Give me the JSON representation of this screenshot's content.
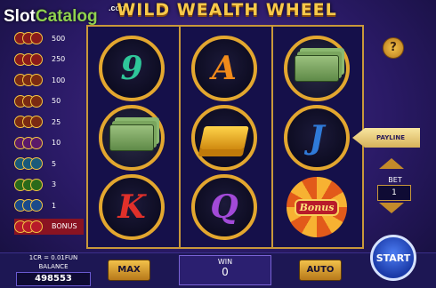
{
  "watermark": {
    "text_a": "Slot",
    "text_b": "Catalog",
    "suffix": ".com"
  },
  "game": {
    "title": "WILD WEALTH WHEEL"
  },
  "paytable": [
    {
      "value": "500",
      "coin_color": "#8a1a1a"
    },
    {
      "value": "250",
      "coin_color": "#8a1a1a"
    },
    {
      "value": "100",
      "coin_color": "#7a2a12"
    },
    {
      "value": "50",
      "coin_color": "#7a2a12"
    },
    {
      "value": "25",
      "coin_color": "#7a2a12"
    },
    {
      "value": "10",
      "coin_color": "#5a1a6a"
    },
    {
      "value": "5",
      "coin_color": "#1a5a7a"
    },
    {
      "value": "3",
      "coin_color": "#2a6a1a"
    },
    {
      "value": "1",
      "coin_color": "#1a4a8a"
    },
    {
      "value": "BONUS",
      "coin_color": "#b81b2a"
    }
  ],
  "reels": [
    [
      {
        "type": "letter",
        "label": "9",
        "color": "#2fc79a"
      },
      {
        "type": "cash"
      },
      {
        "type": "letter",
        "label": "K",
        "color": "#e0302a"
      }
    ],
    [
      {
        "type": "letter",
        "label": "A",
        "color": "#f08a1a"
      },
      {
        "type": "gold"
      },
      {
        "type": "letter",
        "label": "Q",
        "color": "#a24ad8"
      }
    ],
    [
      {
        "type": "cash"
      },
      {
        "type": "letter",
        "label": "J",
        "color": "#2f7ad8"
      },
      {
        "type": "bonus",
        "label": "Bonus"
      }
    ]
  ],
  "controls": {
    "help_label": "?",
    "payline_label": "PAYLINE",
    "bet_label": "BET",
    "bet_value": "1",
    "credit_ratio": "1CR = 0.01FUN",
    "balance_label": "BALANCE",
    "balance_value": "498553",
    "max_label": "MAX",
    "win_label": "WIN",
    "win_value": "0",
    "auto_label": "AUTO",
    "start_label": "START"
  },
  "colors": {
    "accent_gold": "#e3a72f",
    "background": "#2a1a66",
    "start_button": "#1a3aa8"
  }
}
